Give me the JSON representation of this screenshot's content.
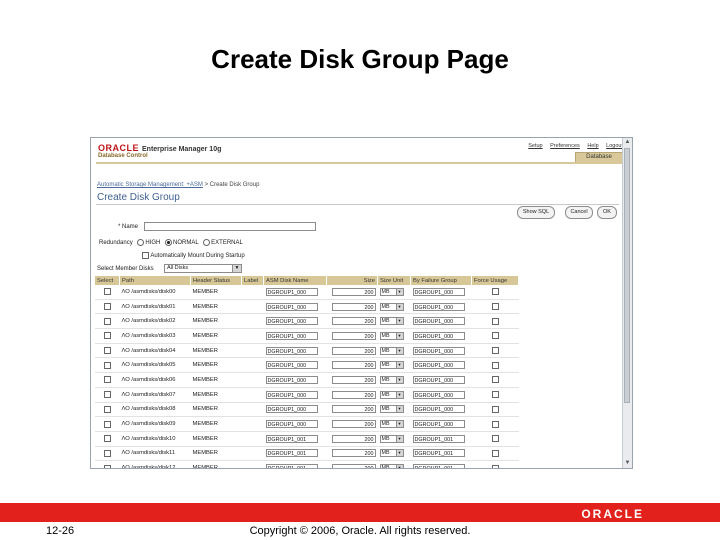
{
  "slide": {
    "title": "Create Disk Group Page",
    "page_number": "12-26",
    "copyright": "Copyright © 2006, Oracle. All rights reserved.",
    "footer_logo": "ORACLE"
  },
  "em": {
    "logo": "ORACLE",
    "product": "Enterprise Manager 10g",
    "subproduct": "Database Control",
    "top_links": [
      "Setup",
      "Preferences",
      "Help",
      "Logout"
    ],
    "database_tab": "Database"
  },
  "breadcrumb": {
    "link": "Automatic Storage Management: +ASM",
    "separator": ">",
    "current": "Create Disk Group"
  },
  "page_heading": "Create Disk Group",
  "buttons": {
    "show_sql": "Show SQL",
    "cancel": "Cancel",
    "ok": "OK"
  },
  "form": {
    "name_label": "* Name",
    "name_value": "",
    "redundancy_label": "Redundancy",
    "redundancy_options": [
      "HIGH",
      "NORMAL",
      "EXTERNAL"
    ],
    "redundancy_selected": "NORMAL",
    "auto_mount_label": "Automatically Mount During Startup",
    "select_member_disks_label": "Select Member Disks",
    "select_member_disks_value": "All Disks"
  },
  "table": {
    "headers": [
      "Select",
      "Path",
      "Header Status",
      "Label",
      "ASM Disk Name",
      "Size",
      "Size Unit",
      "By Failure Group",
      "Force Usage"
    ],
    "rows": [
      {
        "path": "ΛΟ /asmdisks/disk00",
        "status": "MEMBER",
        "disk_name": "DGROUP1_000",
        "size": "200",
        "unit": "MB",
        "fail_group": "DGROUP1_000"
      },
      {
        "path": "ΛΟ /asmdisks/disk01",
        "status": "MEMBER",
        "disk_name": "DGROUP1_000",
        "size": "200",
        "unit": "MB",
        "fail_group": "DGROUP1_000"
      },
      {
        "path": "ΛΟ /asmdisks/disk02",
        "status": "MEMBER",
        "disk_name": "DGROUP1_000",
        "size": "200",
        "unit": "MB",
        "fail_group": "DGROUP1_000"
      },
      {
        "path": "ΛΟ /asmdisks/disk03",
        "status": "MEMBER",
        "disk_name": "DGROUP1_000",
        "size": "200",
        "unit": "MB",
        "fail_group": "DGROUP1_000"
      },
      {
        "path": "ΛΟ /asmdisks/disk04",
        "status": "MEMBER",
        "disk_name": "DGROUP1_000",
        "size": "200",
        "unit": "MB",
        "fail_group": "DGROUP1_000"
      },
      {
        "path": "ΛΟ /asmdisks/disk05",
        "status": "MEMBER",
        "disk_name": "DGROUP1_000",
        "size": "200",
        "unit": "MB",
        "fail_group": "DGROUP1_000"
      },
      {
        "path": "ΛΟ /asmdisks/disk06",
        "status": "MEMBER",
        "disk_name": "DGROUP1_000",
        "size": "200",
        "unit": "MB",
        "fail_group": "DGROUP1_000"
      },
      {
        "path": "ΛΟ /asmdisks/disk07",
        "status": "MEMBER",
        "disk_name": "DGROUP1_000",
        "size": "200",
        "unit": "MB",
        "fail_group": "DGROUP1_000"
      },
      {
        "path": "ΛΟ /asmdisks/disk08",
        "status": "MEMBER",
        "disk_name": "DGROUP1_000",
        "size": "200",
        "unit": "MB",
        "fail_group": "DGROUP1_000"
      },
      {
        "path": "ΛΟ /asmdisks/disk09",
        "status": "MEMBER",
        "disk_name": "DGROUP1_000",
        "size": "200",
        "unit": "MB",
        "fail_group": "DGROUP1_000"
      },
      {
        "path": "ΛΟ /asmdisks/disk10",
        "status": "MEMBER",
        "disk_name": "DGROUP1_001",
        "size": "200",
        "unit": "MB",
        "fail_group": "DGROUP1_001"
      },
      {
        "path": "ΛΟ /asmdisks/disk11",
        "status": "MEMBER",
        "disk_name": "DGROUP1_001",
        "size": "200",
        "unit": "MB",
        "fail_group": "DGROUP1_001"
      },
      {
        "path": "ΛΟ /asmdisks/disk12",
        "status": "MEMBER",
        "disk_name": "DGROUP1_001",
        "size": "200",
        "unit": "MB",
        "fail_group": "DGROUP1_001"
      }
    ]
  },
  "colors": {
    "footer_red": "#e2211c",
    "table_header": "#d7c797",
    "heading_blue": "#3f5f8e",
    "oracle_red": "#c0151b"
  }
}
